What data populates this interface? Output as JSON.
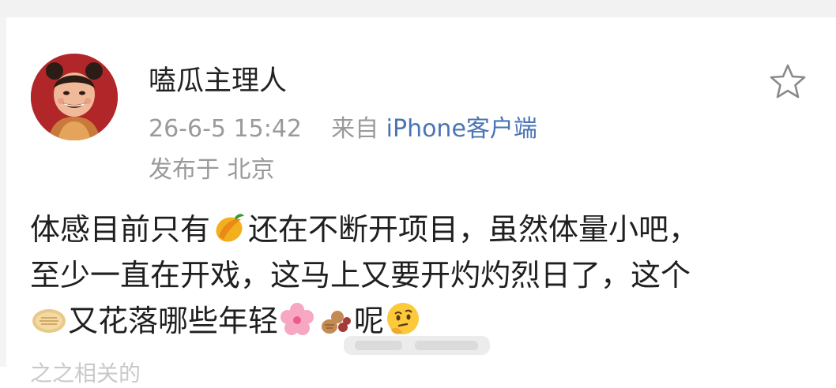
{
  "post": {
    "author": "嗑瓜主理人",
    "timestamp": "26-6-5 15:42",
    "source_prefix": "来自",
    "source_client": "iPhone客户端",
    "location": "发布于 北京",
    "favorite_icon": "star-outline-icon",
    "body_lines": [
      {
        "segments": [
          "体感目前只有",
          "还在不断开项目，虽然体量小吧，"
        ]
      },
      {
        "text": "至少一直在开戏，这马上又要开灼灼烈日了，这个"
      },
      {
        "segments": [
          "又花落哪些年轻",
          "呢"
        ]
      }
    ],
    "emojis": [
      "mango",
      "flatbread",
      "cherry-blossom",
      "peanut",
      "thinking-face"
    ],
    "faded_next_line": "之之相关的"
  }
}
